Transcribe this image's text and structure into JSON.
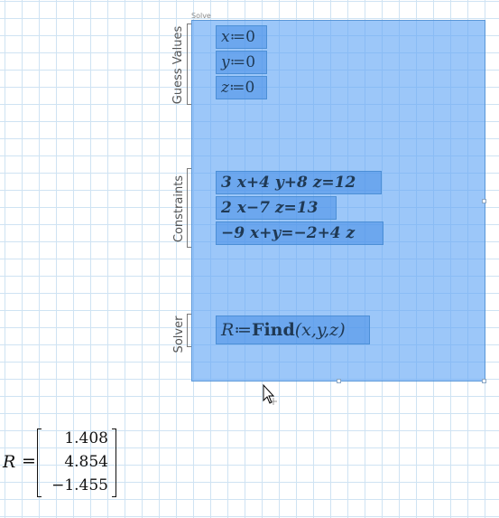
{
  "solve_block": {
    "tag": "Solve",
    "sections": {
      "guess_values_label": "Guess Values",
      "constraints_label": "Constraints",
      "solver_label": "Solver"
    }
  },
  "guess_values": [
    {
      "var": "x",
      "op": "≔",
      "value": "0"
    },
    {
      "var": "y",
      "op": "≔",
      "value": "0"
    },
    {
      "var": "z",
      "op": "≔",
      "value": "0"
    }
  ],
  "constraints": [
    "3 x+4 y+8 z=12",
    "2 x−7 z=13",
    "−9 x+y=−2+4 z"
  ],
  "solver": {
    "lhs": "R",
    "op": "≔",
    "func": "Find",
    "args": "(x,y,z)"
  },
  "result": {
    "var": "R",
    "eq": "=",
    "values": [
      "1.408",
      "4.854",
      "−1.455"
    ]
  },
  "colors": {
    "solve_block_fill": "#8cbef5",
    "region_fill": "#5d9fec",
    "grid_line": "#cfe3f3"
  }
}
